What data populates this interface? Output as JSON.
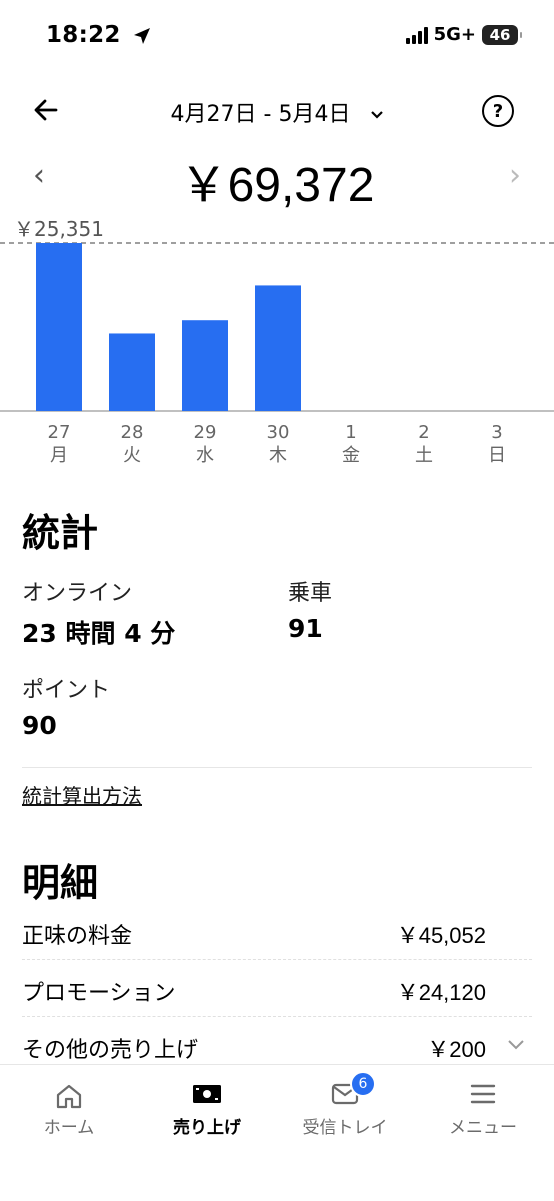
{
  "status_bar": {
    "time": "18:22",
    "network": "5G+",
    "battery": "46"
  },
  "header": {
    "date_range": "4月27日 - 5月4日"
  },
  "summary": {
    "total": "￥69,372"
  },
  "chart_data": {
    "type": "bar",
    "categories": [
      "27",
      "28",
      "29",
      "30",
      "1",
      "2",
      "3"
    ],
    "weekdays": [
      "月",
      "火",
      "水",
      "木",
      "金",
      "土",
      "日"
    ],
    "values": [
      25351,
      11700,
      13700,
      18950,
      0,
      0,
      0
    ],
    "max_label": "￥25,351",
    "reference_line": 25351,
    "ylim": [
      0,
      25351
    ],
    "bar_color": "#276ef1",
    "grid": false
  },
  "stats": {
    "title": "統計",
    "online_label": "オンライン",
    "online_value": "23 時間 4 分",
    "rides_label": "乗車",
    "rides_value": "91",
    "points_label": "ポイント",
    "points_value": "90",
    "method_link": "統計算出方法"
  },
  "details": {
    "title": "明細",
    "rows": [
      {
        "label": "正味の料金",
        "value": "￥45,052"
      },
      {
        "label": "プロモーション",
        "value": "￥24,120"
      },
      {
        "label": "その他の売り上げ",
        "value": "￥200"
      }
    ]
  },
  "tabs": [
    {
      "label": "ホーム",
      "icon": "home-icon"
    },
    {
      "label": "売り上げ",
      "icon": "earnings-icon",
      "active": true
    },
    {
      "label": "受信トレイ",
      "icon": "inbox-icon",
      "badge": "6"
    },
    {
      "label": "メニュー",
      "icon": "menu-icon"
    }
  ],
  "colors": {
    "accent": "#276ef1"
  }
}
